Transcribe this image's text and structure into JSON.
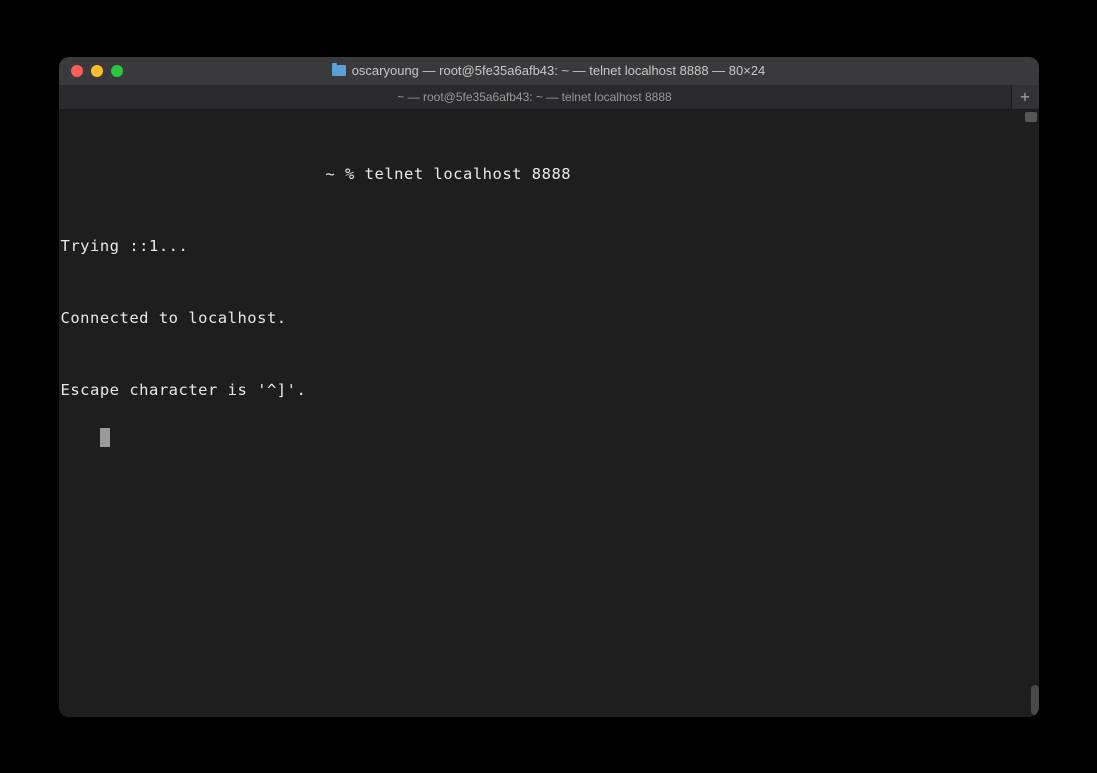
{
  "window": {
    "title": "oscaryoung — root@5fe35a6afb43: ~ — telnet localhost 8888 — 80×24"
  },
  "tab": {
    "label": "~ — root@5fe35a6afb43: ~ — telnet localhost 8888",
    "new_tab_symbol": "+"
  },
  "terminal": {
    "prompt_prefix": " ~ % ",
    "command": "telnet localhost 8888",
    "output_line_1": "Trying ::1...",
    "output_line_2": "Connected to localhost.",
    "output_line_3": "Escape character is '^]'."
  }
}
